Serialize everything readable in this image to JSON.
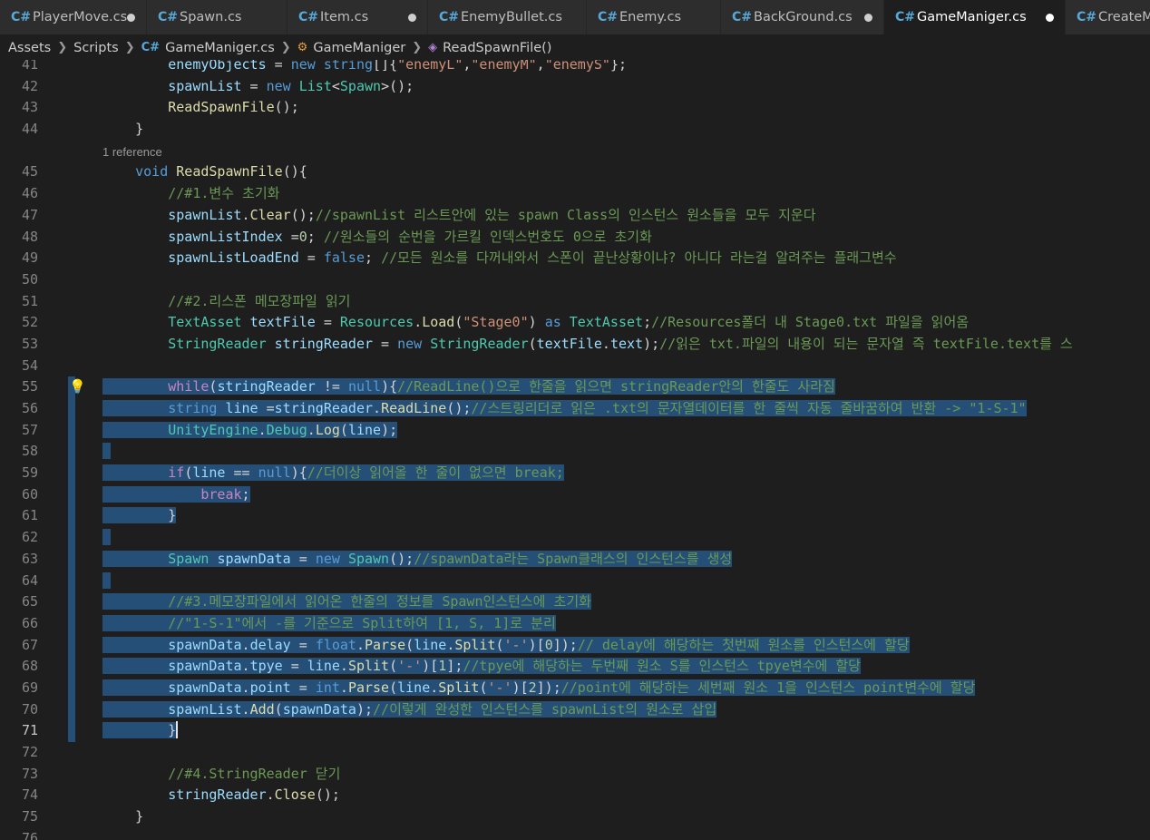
{
  "tabs": [
    {
      "label": "PlayerMove.cs",
      "active": false,
      "dirty": true
    },
    {
      "label": "Spawn.cs",
      "active": false,
      "dirty": false
    },
    {
      "label": "Item.cs",
      "active": false,
      "dirty": true
    },
    {
      "label": "EnemyBullet.cs",
      "active": false,
      "dirty": false
    },
    {
      "label": "Enemy.cs",
      "active": false,
      "dirty": false
    },
    {
      "label": "BackGround.cs",
      "active": false,
      "dirty": true
    },
    {
      "label": "GameManiger.cs",
      "active": true,
      "dirty": true
    },
    {
      "label": "CreateM",
      "active": false,
      "dirty": false
    }
  ],
  "breadcrumb": {
    "folder1": "Assets",
    "folder2": "Scripts",
    "file": "GameManiger.cs",
    "class": "GameManiger",
    "method": "ReadSpawnFile()"
  },
  "codelens": "1 reference",
  "lines": [
    {
      "n": "41",
      "tokens": [
        [
          "ind",
          "        "
        ],
        [
          "va",
          "enemyObjects"
        ],
        [
          "pu",
          " = "
        ],
        [
          "kw",
          "new"
        ],
        [
          "pu",
          " "
        ],
        [
          "kw",
          "string"
        ],
        [
          "pu",
          "[]{"
        ],
        [
          "st",
          "\"enemyL\""
        ],
        [
          "pu",
          ","
        ],
        [
          "st",
          "\"enemyM\""
        ],
        [
          "pu",
          ","
        ],
        [
          "st",
          "\"enemyS\""
        ],
        [
          "pu",
          "};"
        ]
      ]
    },
    {
      "n": "42",
      "tokens": [
        [
          "ind",
          "        "
        ],
        [
          "va",
          "spawnList"
        ],
        [
          "pu",
          " = "
        ],
        [
          "kw",
          "new"
        ],
        [
          "pu",
          " "
        ],
        [
          "ty",
          "List"
        ],
        [
          "pu",
          "<"
        ],
        [
          "ty",
          "Spawn"
        ],
        [
          "pu",
          ">();"
        ]
      ]
    },
    {
      "n": "43",
      "tokens": [
        [
          "ind",
          "        "
        ],
        [
          "fn",
          "ReadSpawnFile"
        ],
        [
          "pu",
          "();"
        ]
      ]
    },
    {
      "n": "44",
      "tokens": [
        [
          "ind",
          "    "
        ],
        [
          "pu",
          "}"
        ]
      ]
    },
    {
      "lens": true
    },
    {
      "n": "45",
      "tokens": [
        [
          "ind",
          "    "
        ],
        [
          "kw",
          "void"
        ],
        [
          "pu",
          " "
        ],
        [
          "fn",
          "ReadSpawnFile"
        ],
        [
          "pu",
          "(){"
        ]
      ]
    },
    {
      "n": "46",
      "tokens": [
        [
          "ind",
          "        "
        ],
        [
          "cm",
          "//#1.변수 초기화"
        ]
      ]
    },
    {
      "n": "47",
      "tokens": [
        [
          "ind",
          "        "
        ],
        [
          "va",
          "spawnList"
        ],
        [
          "pu",
          "."
        ],
        [
          "fn",
          "Clear"
        ],
        [
          "pu",
          "();"
        ],
        [
          "cm",
          "//spawnList 리스트안에 있는 spawn Class의 인스턴스 원소들을 모두 지운다"
        ]
      ]
    },
    {
      "n": "48",
      "tokens": [
        [
          "ind",
          "        "
        ],
        [
          "va",
          "spawnListIndex"
        ],
        [
          "pu",
          " ="
        ],
        [
          "nu",
          "0"
        ],
        [
          "pu",
          "; "
        ],
        [
          "cm",
          "//원소들의 순번을 가르킬 인덱스번호도 0으로 초기화"
        ]
      ]
    },
    {
      "n": "49",
      "tokens": [
        [
          "ind",
          "        "
        ],
        [
          "va",
          "spawnListLoadEnd"
        ],
        [
          "pu",
          " = "
        ],
        [
          "kw",
          "false"
        ],
        [
          "pu",
          "; "
        ],
        [
          "cm",
          "//모든 원소를 다꺼내와서 스폰이 끝난상황이냐? 아니다 라는걸 알려주는 플래그변수"
        ]
      ]
    },
    {
      "n": "50",
      "tokens": []
    },
    {
      "n": "51",
      "tokens": [
        [
          "ind",
          "        "
        ],
        [
          "cm",
          "//#2.리스폰 메모장파일 읽기"
        ]
      ]
    },
    {
      "n": "52",
      "tokens": [
        [
          "ind",
          "        "
        ],
        [
          "ty",
          "TextAsset"
        ],
        [
          "pu",
          " "
        ],
        [
          "va",
          "textFile"
        ],
        [
          "pu",
          " = "
        ],
        [
          "ty",
          "Resources"
        ],
        [
          "pu",
          "."
        ],
        [
          "fn",
          "Load"
        ],
        [
          "pu",
          "("
        ],
        [
          "st",
          "\"Stage0\""
        ],
        [
          "pu",
          ") "
        ],
        [
          "kw",
          "as"
        ],
        [
          "pu",
          " "
        ],
        [
          "ty",
          "TextAsset"
        ],
        [
          "pu",
          ";"
        ],
        [
          "cm",
          "//Resources폴더 내 Stage0.txt 파일을 읽어옴"
        ]
      ]
    },
    {
      "n": "53",
      "tokens": [
        [
          "ind",
          "        "
        ],
        [
          "ty",
          "StringReader"
        ],
        [
          "pu",
          " "
        ],
        [
          "va",
          "stringReader"
        ],
        [
          "pu",
          " = "
        ],
        [
          "kw",
          "new"
        ],
        [
          "pu",
          " "
        ],
        [
          "ty",
          "StringReader"
        ],
        [
          "pu",
          "("
        ],
        [
          "va",
          "textFile"
        ],
        [
          "pu",
          "."
        ],
        [
          "va",
          "text"
        ],
        [
          "pu",
          ");"
        ],
        [
          "cm",
          "//읽은 txt.파일의 내용이 되는 문자열 즉 textFile.text를 스"
        ]
      ]
    },
    {
      "n": "54",
      "tokens": []
    },
    {
      "n": "55",
      "sel": true,
      "bulb": true,
      "tokens": [
        [
          "ind",
          "        "
        ],
        [
          "ctl",
          "while"
        ],
        [
          "pu",
          "("
        ],
        [
          "va",
          "stringReader"
        ],
        [
          "pu",
          " != "
        ],
        [
          "kw",
          "null"
        ],
        [
          "pu",
          "){"
        ],
        [
          "cm",
          "//ReadLine()으로 한줄을 읽으면 stringReader안의 한줄도 사라짐"
        ]
      ]
    },
    {
      "n": "56",
      "sel": true,
      "tokens": [
        [
          "ind",
          "        "
        ],
        [
          "kw",
          "string"
        ],
        [
          "pu",
          " "
        ],
        [
          "va",
          "line"
        ],
        [
          "pu",
          " ="
        ],
        [
          "va",
          "stringReader"
        ],
        [
          "pu",
          "."
        ],
        [
          "fn",
          "ReadLine"
        ],
        [
          "pu",
          "();"
        ],
        [
          "cm",
          "//스트링리더로 읽은 .txt의 문자열데이터를 한 줄씩 자동 줄바꿈하여 반환 -> \"1-S-1\""
        ]
      ]
    },
    {
      "n": "57",
      "sel": true,
      "tokens": [
        [
          "ind",
          "        "
        ],
        [
          "ty",
          "UnityEngine"
        ],
        [
          "pu",
          "."
        ],
        [
          "ty",
          "Debug"
        ],
        [
          "pu",
          "."
        ],
        [
          "fn",
          "Log"
        ],
        [
          "pu",
          "("
        ],
        [
          "va",
          "line"
        ],
        [
          "pu",
          ");"
        ]
      ]
    },
    {
      "n": "58",
      "sel": true,
      "tokens": []
    },
    {
      "n": "59",
      "sel": true,
      "tokens": [
        [
          "ind",
          "        "
        ],
        [
          "ctl",
          "if"
        ],
        [
          "pu",
          "("
        ],
        [
          "va",
          "line"
        ],
        [
          "pu",
          " == "
        ],
        [
          "kw",
          "null"
        ],
        [
          "pu",
          "){"
        ],
        [
          "cm",
          "//더이상 읽어올 한 줄이 없으면 break;"
        ]
      ]
    },
    {
      "n": "60",
      "sel": true,
      "tokens": [
        [
          "ind",
          "            "
        ],
        [
          "ctl",
          "break"
        ],
        [
          "pu",
          ";"
        ]
      ]
    },
    {
      "n": "61",
      "sel": true,
      "tokens": [
        [
          "ind",
          "        "
        ],
        [
          "pu",
          "}"
        ]
      ]
    },
    {
      "n": "62",
      "sel": true,
      "tokens": []
    },
    {
      "n": "63",
      "sel": true,
      "tokens": [
        [
          "ind",
          "        "
        ],
        [
          "ty",
          "Spawn"
        ],
        [
          "pu",
          " "
        ],
        [
          "va",
          "spawnData"
        ],
        [
          "pu",
          " = "
        ],
        [
          "kw",
          "new"
        ],
        [
          "pu",
          " "
        ],
        [
          "ty",
          "Spawn"
        ],
        [
          "pu",
          "();"
        ],
        [
          "cm",
          "//spawnData라는 Spawn클래스의 인스턴스를 생성"
        ]
      ]
    },
    {
      "n": "64",
      "sel": true,
      "tokens": []
    },
    {
      "n": "65",
      "sel": true,
      "tokens": [
        [
          "ind",
          "        "
        ],
        [
          "cm",
          "//#3.메모장파일에서 읽어온 한줄의 정보를 Spawn인스턴스에 초기화"
        ]
      ]
    },
    {
      "n": "66",
      "sel": true,
      "tokens": [
        [
          "ind",
          "        "
        ],
        [
          "cm",
          "//\"1-S-1\"에서 -를 기준으로 Split하여 [1, S, 1]로 분리"
        ]
      ]
    },
    {
      "n": "67",
      "sel": true,
      "tokens": [
        [
          "ind",
          "        "
        ],
        [
          "va",
          "spawnData"
        ],
        [
          "pu",
          "."
        ],
        [
          "va",
          "delay"
        ],
        [
          "pu",
          " = "
        ],
        [
          "kw",
          "float"
        ],
        [
          "pu",
          "."
        ],
        [
          "fn",
          "Parse"
        ],
        [
          "pu",
          "("
        ],
        [
          "va",
          "line"
        ],
        [
          "pu",
          "."
        ],
        [
          "fn",
          "Split"
        ],
        [
          "pu",
          "("
        ],
        [
          "st",
          "'-'"
        ],
        [
          "pu",
          ")["
        ],
        [
          "nu",
          "0"
        ],
        [
          "pu",
          "]);"
        ],
        [
          "cm",
          "// delay에 해당하는 첫번째 원소를 인스턴스에 할당"
        ]
      ]
    },
    {
      "n": "68",
      "sel": true,
      "tokens": [
        [
          "ind",
          "        "
        ],
        [
          "va",
          "spawnData"
        ],
        [
          "pu",
          "."
        ],
        [
          "va",
          "tpye"
        ],
        [
          "pu",
          " = "
        ],
        [
          "va",
          "line"
        ],
        [
          "pu",
          "."
        ],
        [
          "fn",
          "Split"
        ],
        [
          "pu",
          "("
        ],
        [
          "st",
          "'-'"
        ],
        [
          "pu",
          ")["
        ],
        [
          "nu",
          "1"
        ],
        [
          "pu",
          "];"
        ],
        [
          "cm",
          "//tpye에 해당하는 두번째 원소 S를 인스턴스 tpye변수에 할당"
        ]
      ]
    },
    {
      "n": "69",
      "sel": true,
      "tokens": [
        [
          "ind",
          "        "
        ],
        [
          "va",
          "spawnData"
        ],
        [
          "pu",
          "."
        ],
        [
          "va",
          "point"
        ],
        [
          "pu",
          " = "
        ],
        [
          "kw",
          "int"
        ],
        [
          "pu",
          "."
        ],
        [
          "fn",
          "Parse"
        ],
        [
          "pu",
          "("
        ],
        [
          "va",
          "line"
        ],
        [
          "pu",
          "."
        ],
        [
          "fn",
          "Split"
        ],
        [
          "pu",
          "("
        ],
        [
          "st",
          "'-'"
        ],
        [
          "pu",
          ")["
        ],
        [
          "nu",
          "2"
        ],
        [
          "pu",
          "]);"
        ],
        [
          "cm",
          "//point에 해당하는 세번째 원소 1을 인스턴스 point변수에 할당"
        ]
      ]
    },
    {
      "n": "70",
      "sel": true,
      "tokens": [
        [
          "ind",
          "        "
        ],
        [
          "va",
          "spawnList"
        ],
        [
          "pu",
          "."
        ],
        [
          "fn",
          "Add"
        ],
        [
          "pu",
          "("
        ],
        [
          "va",
          "spawnData"
        ],
        [
          "pu",
          ");"
        ],
        [
          "cm",
          "//이렇게 완성한 인스턴스를 spawnList의 원소로 삽입"
        ]
      ]
    },
    {
      "n": "71",
      "sel": true,
      "cur": true,
      "caret": true,
      "tokens": [
        [
          "ind",
          "        "
        ],
        [
          "pu",
          "}"
        ]
      ]
    },
    {
      "n": "72",
      "tokens": []
    },
    {
      "n": "73",
      "tokens": [
        [
          "ind",
          "        "
        ],
        [
          "cm",
          "//#4.StringReader 닫기"
        ]
      ]
    },
    {
      "n": "74",
      "tokens": [
        [
          "ind",
          "        "
        ],
        [
          "va",
          "stringReader"
        ],
        [
          "pu",
          "."
        ],
        [
          "fn",
          "Close"
        ],
        [
          "pu",
          "();"
        ]
      ]
    },
    {
      "n": "75",
      "tokens": [
        [
          "ind",
          "    "
        ],
        [
          "pu",
          "}"
        ]
      ]
    },
    {
      "n": "76",
      "tokens": []
    }
  ]
}
